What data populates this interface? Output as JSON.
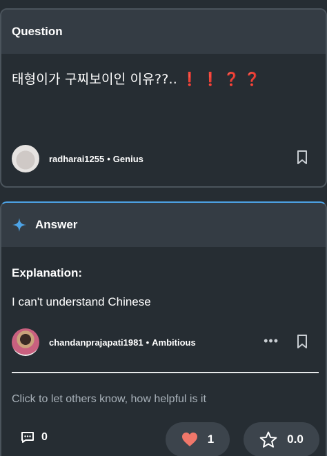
{
  "question": {
    "header": "Question",
    "text": "태형이가 구찌보이인 이유??..",
    "emojis": [
      "❗",
      "❗",
      "❓",
      "❓"
    ],
    "author": {
      "name": "radharai1255",
      "separator": "•",
      "rank": "Genius"
    }
  },
  "answer": {
    "header": "Answer",
    "explanation_title": "Explanation:",
    "explanation_text": "I can't understand Chinese",
    "author": {
      "name": "chandanprajapati1981",
      "separator": "•",
      "rank": "Ambitious"
    },
    "more_label": "•••",
    "helpful_prompt": "Click to let others know, how helpful is it",
    "comments_count": "0",
    "likes_count": "1",
    "rating": "0.0"
  },
  "colors": {
    "background": "#262d33",
    "header_bg": "#343c44",
    "accent_blue": "#4da3e6",
    "heart": "#f0776a",
    "emoji_red": "#e8453c"
  },
  "icons": [
    "bookmark-icon",
    "sparkle-icon",
    "comment-icon",
    "heart-icon",
    "star-icon",
    "more-icon"
  ]
}
